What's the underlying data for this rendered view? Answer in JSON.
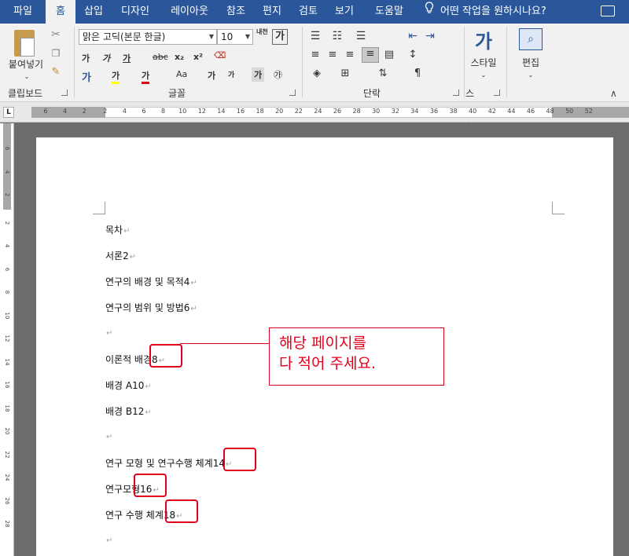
{
  "tabs": [
    {
      "label": "파일",
      "active": false
    },
    {
      "label": "홈",
      "active": true
    },
    {
      "label": "삽입",
      "active": false
    },
    {
      "label": "디자인",
      "active": false
    },
    {
      "label": "레이아웃",
      "active": false
    },
    {
      "label": "참조",
      "active": false
    },
    {
      "label": "편지",
      "active": false
    },
    {
      "label": "검토",
      "active": false
    },
    {
      "label": "보기",
      "active": false
    },
    {
      "label": "도움말",
      "active": false
    }
  ],
  "tell_me": "어떤 작업을 원하시나요?",
  "ribbon": {
    "clipboard": {
      "label": "클립보드",
      "paste_label": "붙여넣기"
    },
    "font": {
      "label": "글꼴",
      "font_name": "맑은 고딕(본문 한글)",
      "font_size": "10",
      "bold": "가",
      "italic": "가",
      "underline": "가",
      "strike": "abc",
      "subscript": "x₂",
      "superscript": "x²",
      "case": "Aa",
      "grow": "가",
      "shrink": "가",
      "char_shade": "가",
      "enclosed": "㉮",
      "phonetic": "내천",
      "char_border": "가"
    },
    "paragraph": {
      "label": "단락"
    },
    "styles": {
      "label": "스타일",
      "button": "스타일",
      "icon_text": "가"
    },
    "editing": {
      "label": "편집",
      "button": "편집"
    }
  },
  "ruler": {
    "numbers": [
      "6",
      "4",
      "2",
      "2",
      "4",
      "6",
      "8",
      "10",
      "12",
      "14",
      "16",
      "18",
      "20",
      "22",
      "24",
      "26",
      "28",
      "30",
      "32",
      "34",
      "36",
      "38",
      "40",
      "42",
      "44",
      "46",
      "48",
      "50",
      "52"
    ],
    "vertical_numbers": [
      "6",
      "4",
      "2",
      "2",
      "4",
      "6",
      "8",
      "10",
      "12",
      "14",
      "16",
      "18",
      "20",
      "22",
      "24",
      "26",
      "28"
    ]
  },
  "document": {
    "lines": [
      "목차",
      "서론2",
      "연구의 배경 및 목적4",
      "연구의 범위 및 방법6",
      "",
      "이론적 배경8",
      "배경 A10",
      "배경 B12",
      "",
      "연구 모형 및 연구수행 체계14",
      "연구모형16",
      "연구 수행 체계18",
      ""
    ],
    "paragraph_mark": "↵"
  },
  "annotation": {
    "text_line1": "해당 페이지를",
    "text_line2": "다 적어 주세요.",
    "color": "#e0001b"
  },
  "colors": {
    "ribbon_blue": "#2b579a",
    "highlight": "#e0001b"
  }
}
